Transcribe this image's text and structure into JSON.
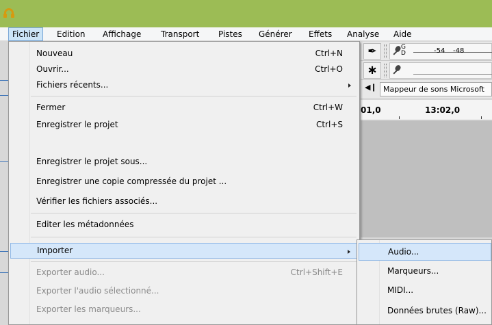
{
  "menubar": {
    "items": [
      "Fichier",
      "Edition",
      "Affichage",
      "Transport",
      "Pistes",
      "Générer",
      "Effets",
      "Analyse",
      "Aide"
    ],
    "active": "Fichier"
  },
  "file_menu": {
    "items": [
      {
        "label": "Nouveau",
        "shortcut": "Ctrl+N"
      },
      {
        "label": "Ouvrir...",
        "shortcut": "Ctrl+O"
      },
      {
        "label": "Fichiers récents...",
        "shortcut": ""
      },
      {
        "label": "Fermer",
        "shortcut": "Ctrl+W"
      },
      {
        "label": "Enregistrer le projet",
        "shortcut": "Ctrl+S"
      },
      {
        "label": "Enregistrer le projet sous...",
        "shortcut": ""
      },
      {
        "label": "Enregistrer une copie compressée du projet ...",
        "shortcut": ""
      },
      {
        "label": "Vérifier les fichiers associés...",
        "shortcut": ""
      },
      {
        "label": "Editer les métadonnées",
        "shortcut": ""
      },
      {
        "label": "Importer",
        "shortcut": ""
      },
      {
        "label": "Exporter audio...",
        "shortcut": "Ctrl+Shift+E"
      },
      {
        "label": "Exporter l'audio sélectionné...",
        "shortcut": ""
      },
      {
        "label": "Exporter les marqueurs...",
        "shortcut": ""
      }
    ]
  },
  "import_submenu": {
    "items": [
      "Audio...",
      "Marqueurs...",
      "MIDI...",
      "Données brutes (Raw)..."
    ]
  },
  "toolbar": {
    "meter_channels_g": "G",
    "meter_channels_d": "D",
    "meter_values": [
      "-54",
      "-48"
    ],
    "device_label": "Mappeur de sons Microsoft"
  },
  "timeline": {
    "labels": [
      "01,0",
      "13:02,0"
    ]
  }
}
